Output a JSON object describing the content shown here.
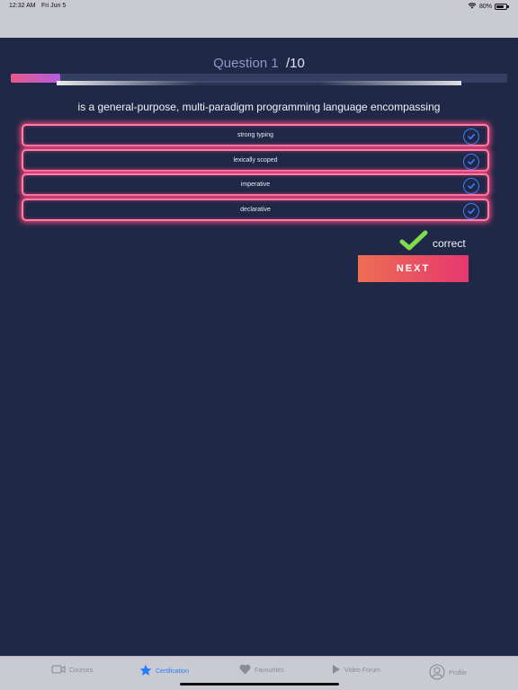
{
  "status_bar": {
    "time": "12:32 AM",
    "date": "Fri Jun 5",
    "battery": "80%"
  },
  "quiz": {
    "question_label": "Question 1",
    "question_total": "/10",
    "progress": 0.1,
    "question_text": "is a general-purpose, multi-paradigm programming language encompassing",
    "options": [
      {
        "label": "strong typing"
      },
      {
        "label": "lexically scoped"
      },
      {
        "label": "imperative"
      },
      {
        "label": "declarative"
      }
    ],
    "feedback": "correct",
    "next_label": "NEXT"
  },
  "colors": {
    "accent": "#e5386f",
    "glow": "#ff4682",
    "check": "#3e7dff",
    "correct": "#7fdc4a",
    "tab_active": "#2b7bff"
  },
  "tabs": [
    {
      "label": "Courses",
      "icon": "video-camera-icon",
      "active": false
    },
    {
      "label": "Certification",
      "icon": "star-icon",
      "active": true
    },
    {
      "label": "Favourites",
      "icon": "heart-icon",
      "active": false
    },
    {
      "label": "Video Forum",
      "icon": "play-icon",
      "active": false
    },
    {
      "label": "Profile",
      "icon": "user-circle-icon",
      "active": false
    }
  ]
}
